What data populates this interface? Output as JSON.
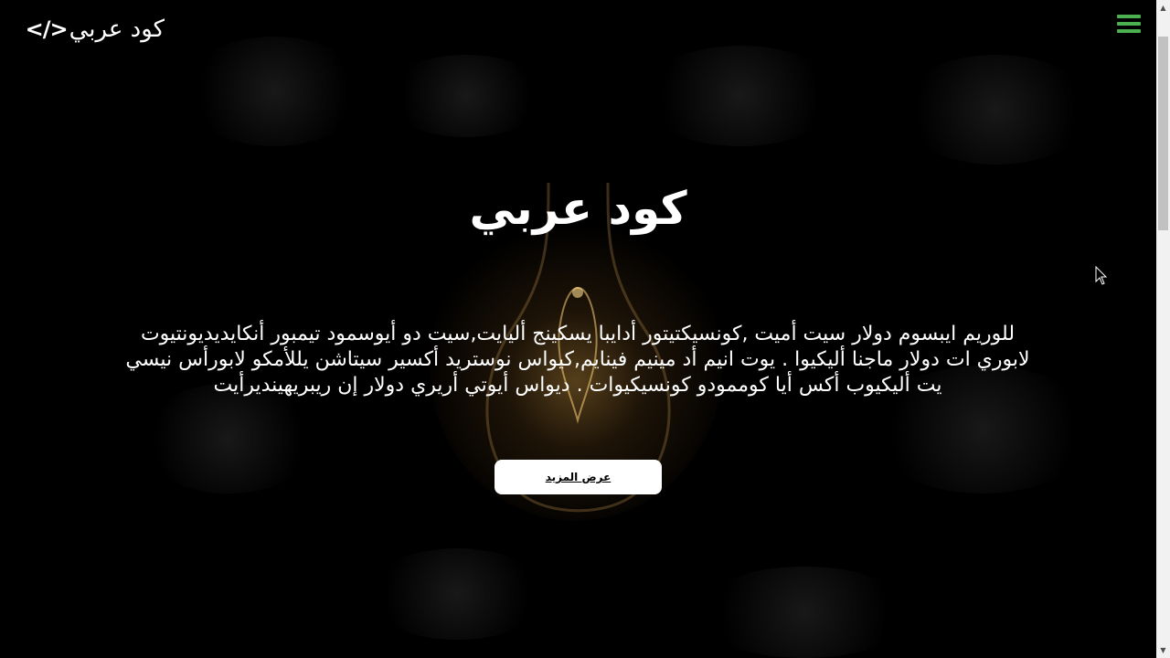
{
  "header": {
    "logo_text": "كود عربي",
    "logo_icon_glyph": "</>",
    "logo_icon": "code-brackets-icon",
    "menu_icon": "hamburger-menu-icon",
    "accent_color": "#4caf50"
  },
  "hero": {
    "title": "كود عربي",
    "description": "للوريم ايبسوم دولار سيت أميت ,كونسيكتيتور أدايبا يسكينج أليايت,سيت دو أيوسمود تيمبور أنكايديديونتيوت لابوري ات دولار ماجنا أليكيوا . يوت انيم أد مينيم فينايم,كيواس نوستريد أكسير سيتاشن يللأمكو لابورأس نيسي يت أليكيوب أكس أيا كوممودو كونسيكيوات . ديواس أيوتي أريري دولار إن ريبريهينديرأيت",
    "button_label": "عرض المزيد"
  },
  "scrollbar": {
    "up_arrow": "▲",
    "down_arrow": "▼"
  }
}
